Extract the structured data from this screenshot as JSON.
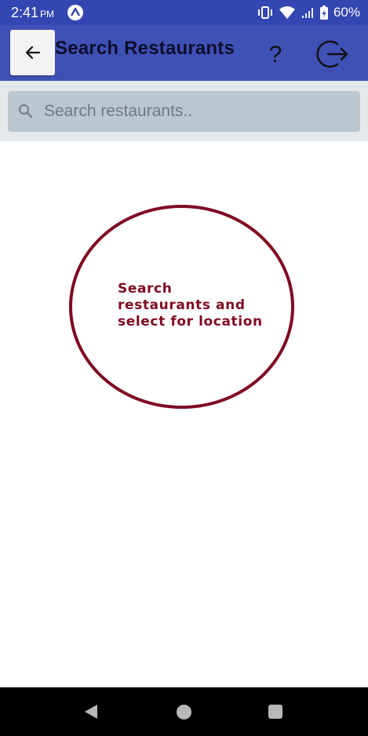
{
  "status_bar": {
    "time": "2:41",
    "ampm": "PM",
    "battery": "60%"
  },
  "app_bar": {
    "title": "Search Restaurants",
    "help_label": "?"
  },
  "search": {
    "placeholder": "Search restaurants..",
    "value": ""
  },
  "hint": {
    "text_line1": "Search",
    "text_line2": "restaurants and",
    "text_line3": "select for location"
  },
  "colors": {
    "status_bar": "#3346b1",
    "app_bar": "#3f51b5",
    "hint_accent": "#7f0a22",
    "search_box": "#bcc6cf"
  },
  "icons": {
    "back": "arrow-left-icon",
    "help": "question-mark-icon",
    "logout": "logout-icon",
    "search": "search-icon"
  }
}
